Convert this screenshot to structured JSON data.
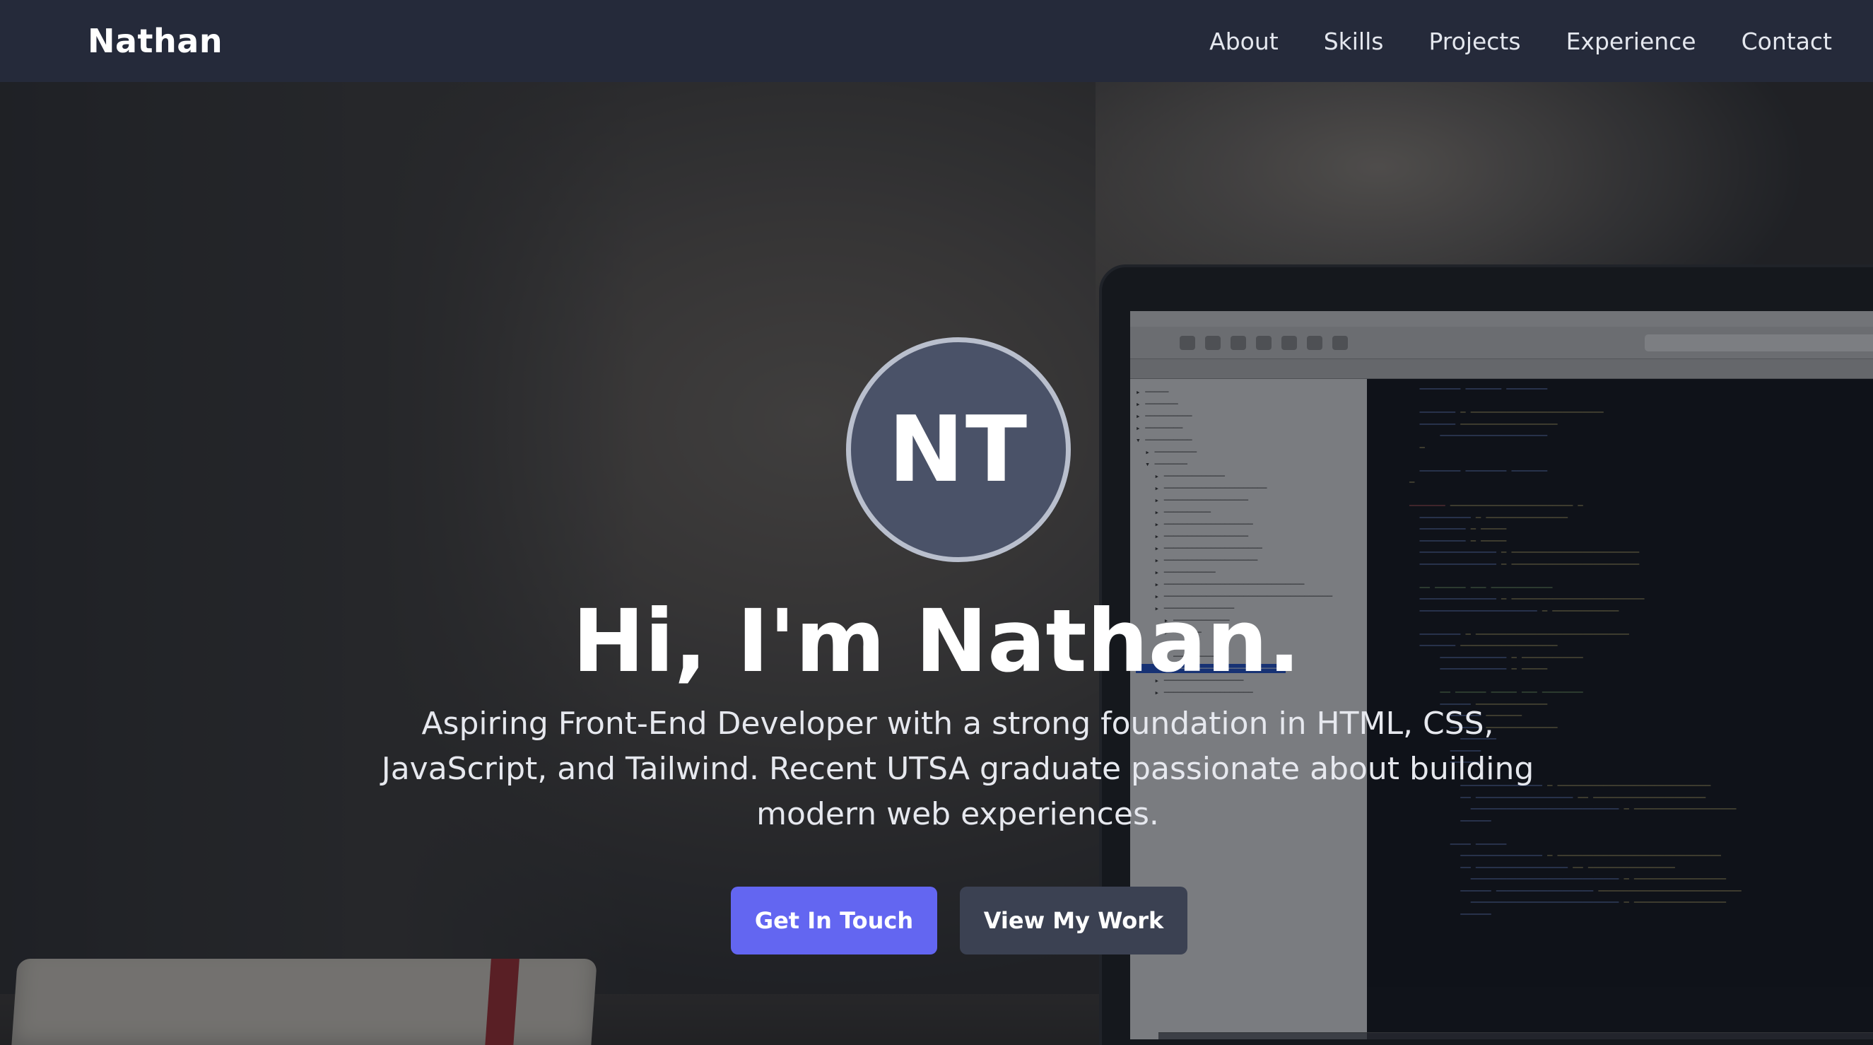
{
  "nav": {
    "brand": "Nathan",
    "links": [
      "About",
      "Skills",
      "Projects",
      "Experience",
      "Contact"
    ]
  },
  "hero": {
    "avatar_initials": "NT",
    "title": "Hi, I'm Nathan.",
    "subtitle": "Aspiring Front-End Developer with a strong foundation in HTML, CSS, JavaScript, and Tailwind. Recent UTSA graduate passionate about building modern web experiences.",
    "primary_button": "Get In Touch",
    "secondary_button": "View My Work"
  },
  "colors": {
    "navbar_bg": "#252a3a",
    "primary_button": "#6366f1",
    "secondary_button": "#3b4152",
    "avatar_bg": "#4a5268"
  }
}
